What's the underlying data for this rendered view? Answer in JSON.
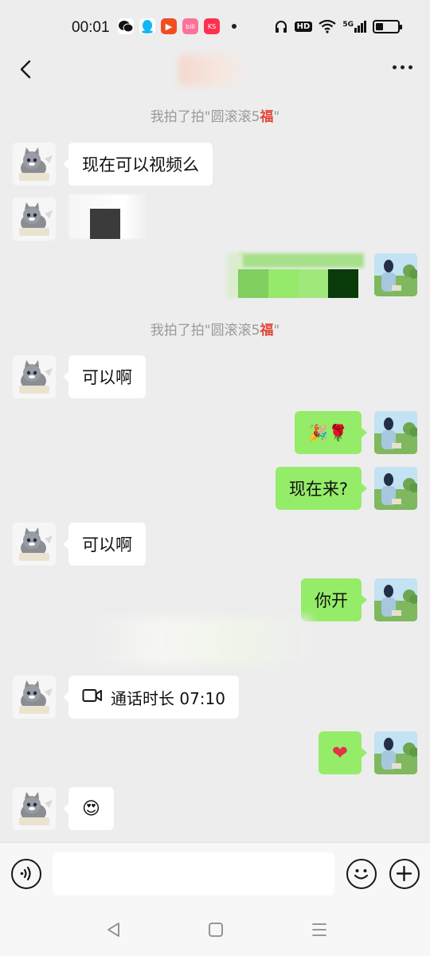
{
  "status_bar": {
    "time": "00:01",
    "network": "5G",
    "app_icons": [
      "wechat-icon",
      "qq-icon",
      "video-app-icon",
      "bilibili-app-icon",
      "kuaishou-app-icon"
    ],
    "battery_level": 0.35
  },
  "header": {
    "back_icon": "chevron-left-icon",
    "more_icon": "more-dots-icon"
  },
  "system_messages": [
    {
      "prefix": "我拍了拍\"圆滚滚5",
      "fu": "福",
      "suffix": "\""
    },
    {
      "prefix": "我拍了拍\"圆滚滚5",
      "fu": "福",
      "suffix": "\""
    }
  ],
  "messages": [
    {
      "side": "left",
      "text": "现在可以视频么"
    },
    {
      "side": "left",
      "text": "可以啊"
    },
    {
      "side": "right",
      "text": "🎉🌹"
    },
    {
      "side": "right",
      "text": "现在来?"
    },
    {
      "side": "left",
      "text": "可以啊"
    },
    {
      "side": "right",
      "text": "你开"
    },
    {
      "side": "left",
      "text": "通话时长 07:10",
      "icon": "video-camera-icon"
    },
    {
      "side": "right",
      "text": "❤"
    },
    {
      "side": "left",
      "text": "😍"
    }
  ],
  "input_bar": {
    "voice_icon": "voice-icon",
    "emoji_icon": "emoji-icon",
    "plus_icon": "plus-icon",
    "placeholder": ""
  },
  "colors": {
    "background": "#ededed",
    "self_bubble": "#95ec69",
    "other_bubble": "#ffffff",
    "system_text": "#9a9a9a",
    "fu_red": "#e0483a"
  }
}
